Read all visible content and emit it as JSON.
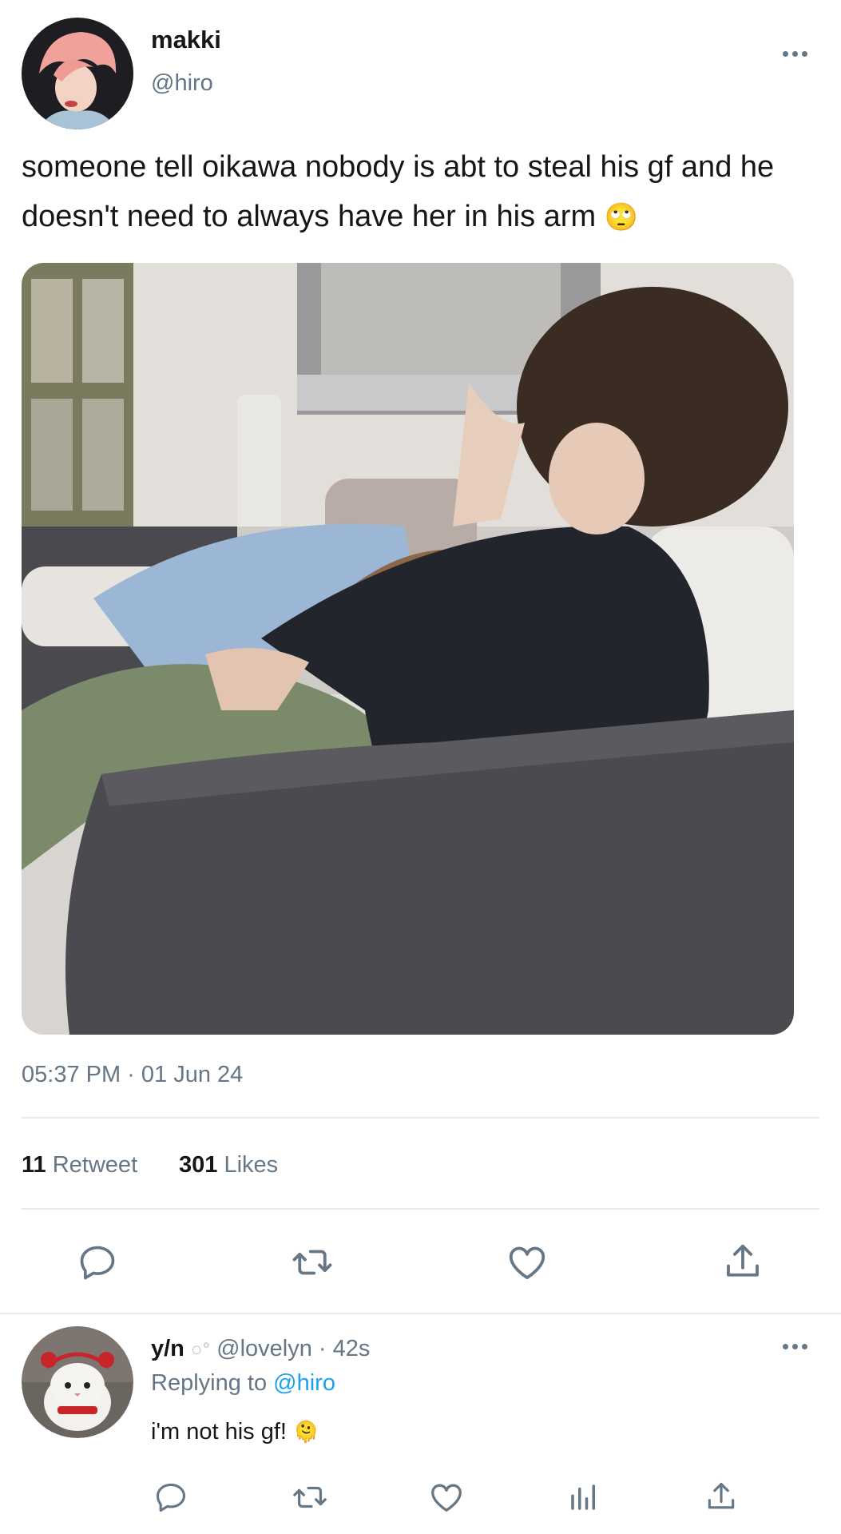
{
  "tweet": {
    "author_name": "makki",
    "author_handle": "@hiro",
    "text": "someone tell oikawa nobody is abt to steal his gf and he doesn't need to always have her in his arm",
    "emoji": "🙄",
    "timestamp": "05:37 PM · 01 Jun 24",
    "stats": {
      "retweet_count": "11",
      "retweet_label": "Retweet",
      "like_count": "301",
      "like_label": "Likes"
    }
  },
  "actions": {
    "icons": [
      "reply-icon",
      "retweet-icon",
      "like-icon",
      "share-icon"
    ]
  },
  "reply": {
    "author_name": "y/n",
    "author_handle_time": "@lovelyn · 42s",
    "replying_prefix": "Replying to",
    "replying_handle": "@hiro",
    "text": "i'm not his gf!",
    "emoji": "🫠",
    "icons": [
      "reply-icon",
      "retweet-icon",
      "like-icon",
      "views-icon",
      "share-icon"
    ]
  },
  "colors": {
    "link": "#1da1f2",
    "muted": "#657786",
    "divider": "#e6ecf0",
    "text": "#14171a"
  }
}
